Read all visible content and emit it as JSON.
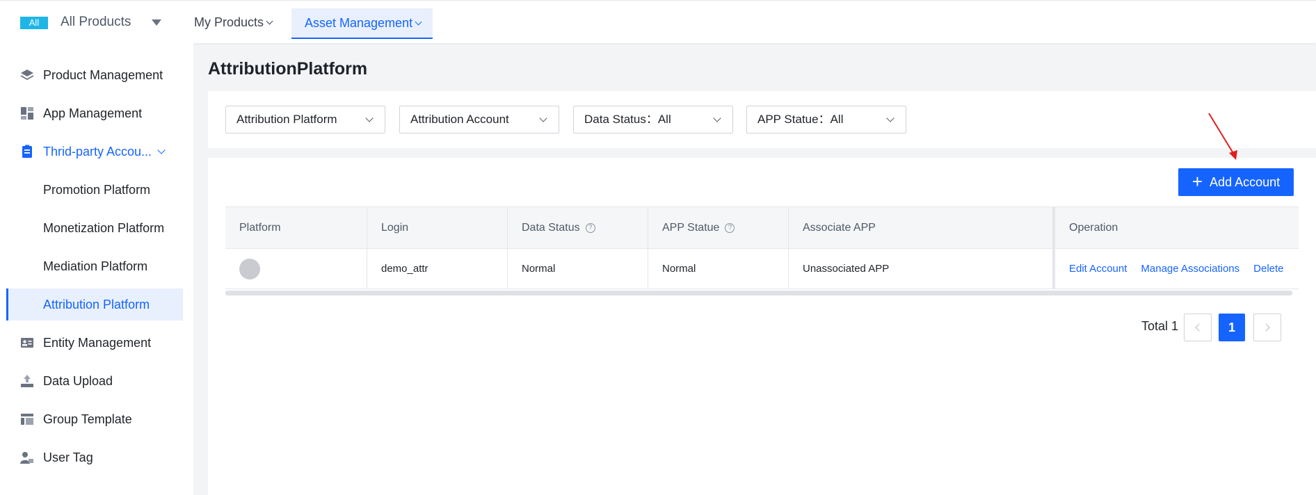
{
  "topnav": {
    "all_badge": "All",
    "all_products": "All Products",
    "tabs": [
      {
        "label": "My Products"
      },
      {
        "label": "Asset Management"
      }
    ]
  },
  "sidebar": {
    "items": [
      {
        "label": "Product Management",
        "icon": "layers-icon"
      },
      {
        "label": "App Management",
        "icon": "app-grid-icon"
      },
      {
        "label": "Thrid-party Accou...",
        "icon": "clipboard-icon"
      },
      {
        "label": "Promotion Platform"
      },
      {
        "label": "Monetization Platform"
      },
      {
        "label": "Mediation Platform"
      },
      {
        "label": "Attribution Platform"
      },
      {
        "label": "Entity Management",
        "icon": "id-card-icon"
      },
      {
        "label": "Data Upload",
        "icon": "upload-icon"
      },
      {
        "label": "Group Template",
        "icon": "template-icon"
      },
      {
        "label": "User Tag",
        "icon": "user-tag-icon"
      }
    ]
  },
  "main": {
    "title": "AttributionPlatform",
    "filters": [
      {
        "label": "Attribution Platform"
      },
      {
        "label": "Attribution Account"
      },
      {
        "label": "Data Status：All"
      },
      {
        "label": "APP Statue：All"
      }
    ],
    "add_button": "Add Account",
    "table": {
      "headers": [
        "Platform",
        "Login",
        "Data Status",
        "APP Statue",
        "Associate APP",
        "Operation"
      ],
      "rows": [
        {
          "platform": "",
          "login": "demo_attr",
          "data_status": "Normal",
          "app_statue": "Normal",
          "associate_app": "Unassociated APP",
          "ops": [
            "Edit Account",
            "Manage Associations",
            "Delete"
          ]
        }
      ]
    },
    "pagination": {
      "total": "Total 1",
      "current": "1"
    }
  },
  "colors": {
    "accent": "#1664ff",
    "badge": "#1fb6e6",
    "annotation_arrow": "#e11d1d"
  }
}
